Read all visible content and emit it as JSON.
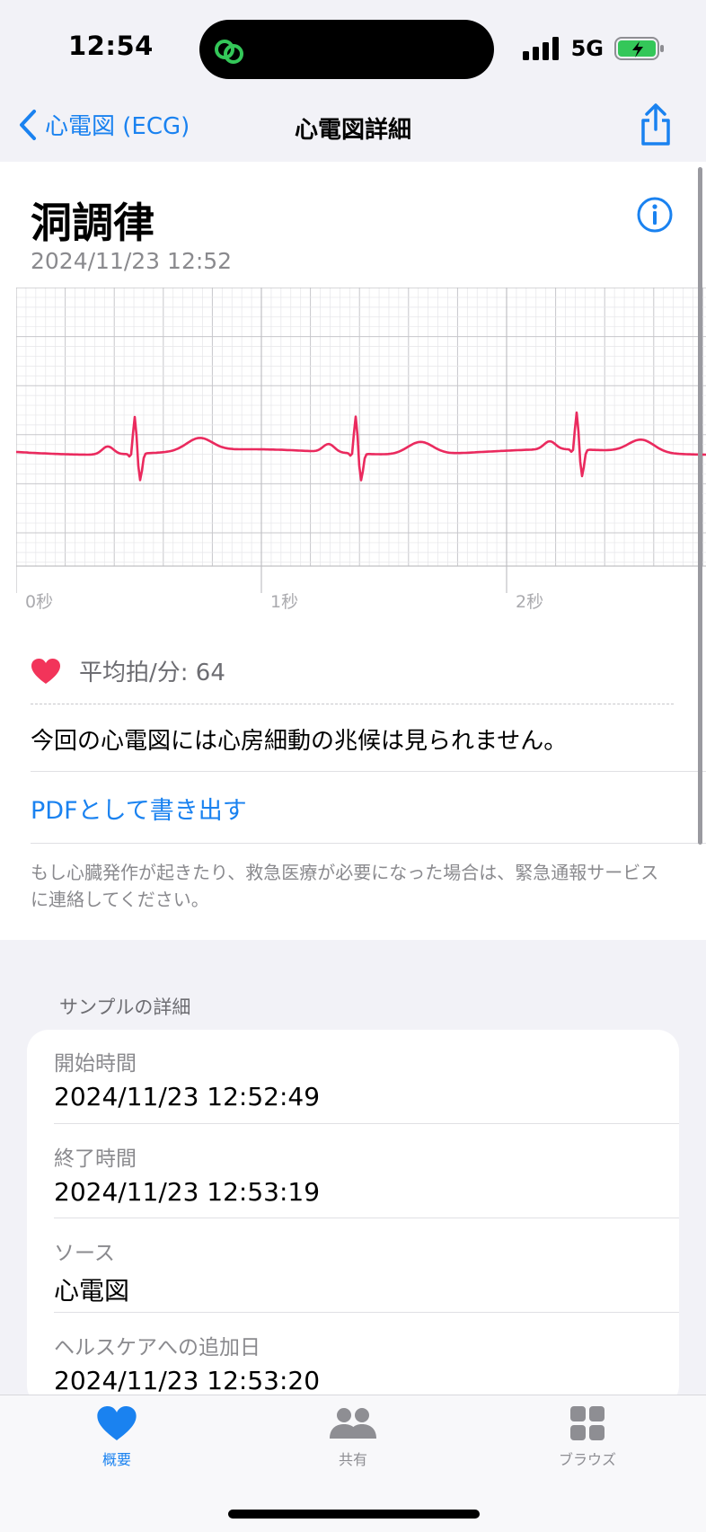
{
  "status_bar": {
    "time": "12:54",
    "network": "5G"
  },
  "nav": {
    "back_label": "心電図 (ECG)",
    "title": "心電図詳細"
  },
  "recording": {
    "rhythm": "洞調律",
    "datetime": "2024/11/23 12:52",
    "time_axis_labels": [
      "0秒",
      "1秒",
      "2秒"
    ],
    "avg_bpm_label": "平均拍/分: 64",
    "result_text": "今回の心電図には心房細動の兆候は見られません。",
    "export_pdf_label": "PDFとして書き出す",
    "emergency_note": "もし心臓発作が起きたり、救急医療が必要になった場合は、緊急通報サービスに連絡してください。"
  },
  "sample_details": {
    "header": "サンプルの詳細",
    "rows": [
      {
        "label": "開始時間",
        "value": "2024/11/23 12:52:49"
      },
      {
        "label": "終了時間",
        "value": "2024/11/23 12:53:19"
      },
      {
        "label": "ソース",
        "value": "心電図"
      },
      {
        "label": "ヘルスケアへの追加日",
        "value": "2024/11/23 12:53:20"
      }
    ]
  },
  "tabs": [
    {
      "label": "概要",
      "active": true,
      "icon": "heart-icon"
    },
    {
      "label": "共有",
      "active": false,
      "icon": "people-icon"
    },
    {
      "label": "ブラウズ",
      "active": false,
      "icon": "grid-icon"
    }
  ],
  "colors": {
    "accent": "#1a82f0",
    "ecg_trace": "#ea2a5e",
    "heart": "#f2345a",
    "battery": "#34c759"
  }
}
